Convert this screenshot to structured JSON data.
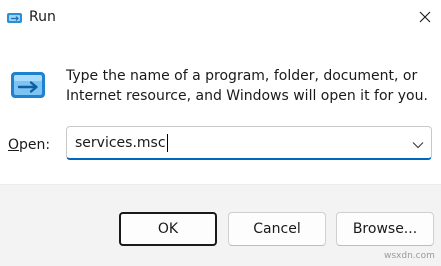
{
  "window": {
    "title": "Run",
    "close_icon": "close-icon",
    "app_icon": "run-icon"
  },
  "body": {
    "description_line1": "Type the name of a program, folder, document, or",
    "description_line2": "Internet resource, and Windows will open it for you."
  },
  "open_field": {
    "label_mnemonic": "O",
    "label_rest": "pen:",
    "value": "services.msc",
    "dropdown_icon": "chevron-down-icon"
  },
  "buttons": {
    "ok": "OK",
    "cancel": "Cancel",
    "browse": "Browse..."
  },
  "watermark": "wsxdn.com",
  "colors": {
    "accent": "#0067c0",
    "footer_bg": "#f3f3f3",
    "icon_blue": "#2b8fd6"
  }
}
